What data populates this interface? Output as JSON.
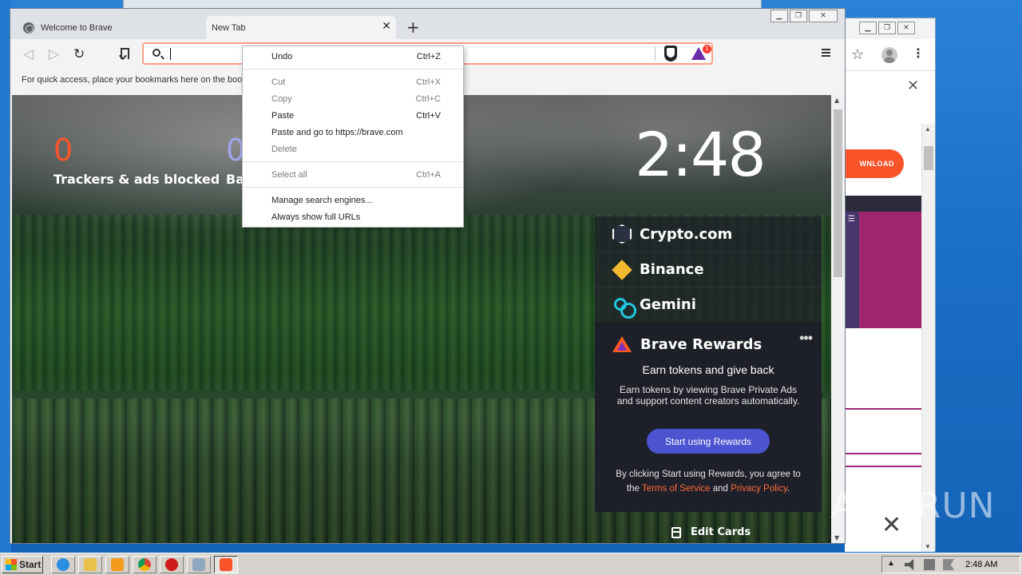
{
  "browser": {
    "tabs": [
      {
        "label": "Welcome to Brave",
        "active": false
      },
      {
        "label": "New Tab",
        "active": true
      }
    ],
    "address_bar": {
      "value": ""
    },
    "rewards_badge_count": "1",
    "bookmarks_hint": "For quick access, place your bookmarks here on the bookmarks bar."
  },
  "context_menu": {
    "groups": [
      [
        {
          "label": "Undo",
          "shortcut": "Ctrl+Z",
          "enabled": true
        }
      ],
      [
        {
          "label": "Cut",
          "shortcut": "Ctrl+X",
          "enabled": false
        },
        {
          "label": "Copy",
          "shortcut": "Ctrl+C",
          "enabled": false
        },
        {
          "label": "Paste",
          "shortcut": "Ctrl+V",
          "enabled": true
        },
        {
          "label": "Paste and go to https://brave.com",
          "shortcut": "",
          "enabled": true
        },
        {
          "label": "Delete",
          "shortcut": "",
          "enabled": false
        }
      ],
      [
        {
          "label": "Select all",
          "shortcut": "Ctrl+A",
          "enabled": false
        }
      ],
      [
        {
          "label": "Manage search engines...",
          "shortcut": "",
          "enabled": true
        },
        {
          "label": "Always show full URLs",
          "shortcut": "",
          "enabled": true
        }
      ]
    ]
  },
  "new_tab_page": {
    "stats": {
      "trackers": {
        "value": "0",
        "label": "Trackers & ads blocked"
      },
      "bandwidth": {
        "value": "0",
        "label": "Ba"
      }
    },
    "clock": "2:48",
    "widgets": {
      "crypto_com": "Crypto.com",
      "binance": "Binance",
      "gemini": "Gemini"
    },
    "rewards": {
      "title": "Brave Rewards",
      "more": "•••",
      "heading": "Earn tokens and give back",
      "description": "Earn tokens by viewing Brave Private Ads and support content creators automatically.",
      "button": "Start using Rewards",
      "terms_prefix": "By clicking Start using Rewards, you agree to the",
      "terms_link": "Terms of Service",
      "terms_and": "and",
      "privacy_link": "Privacy Policy",
      "terms_suffix": "."
    },
    "edit_cards": "Edit Cards"
  },
  "background_window": {
    "download_label": "WNLOAD"
  },
  "watermark": "ANY RUN",
  "taskbar": {
    "start_label": "Start",
    "clock": "2:48 AM"
  },
  "colors": {
    "brave_orange": "#fb542b",
    "rewards_button": "#4c54d2",
    "binance_yellow": "#f3ba2f",
    "gemini_cyan": "#21c8e0"
  }
}
